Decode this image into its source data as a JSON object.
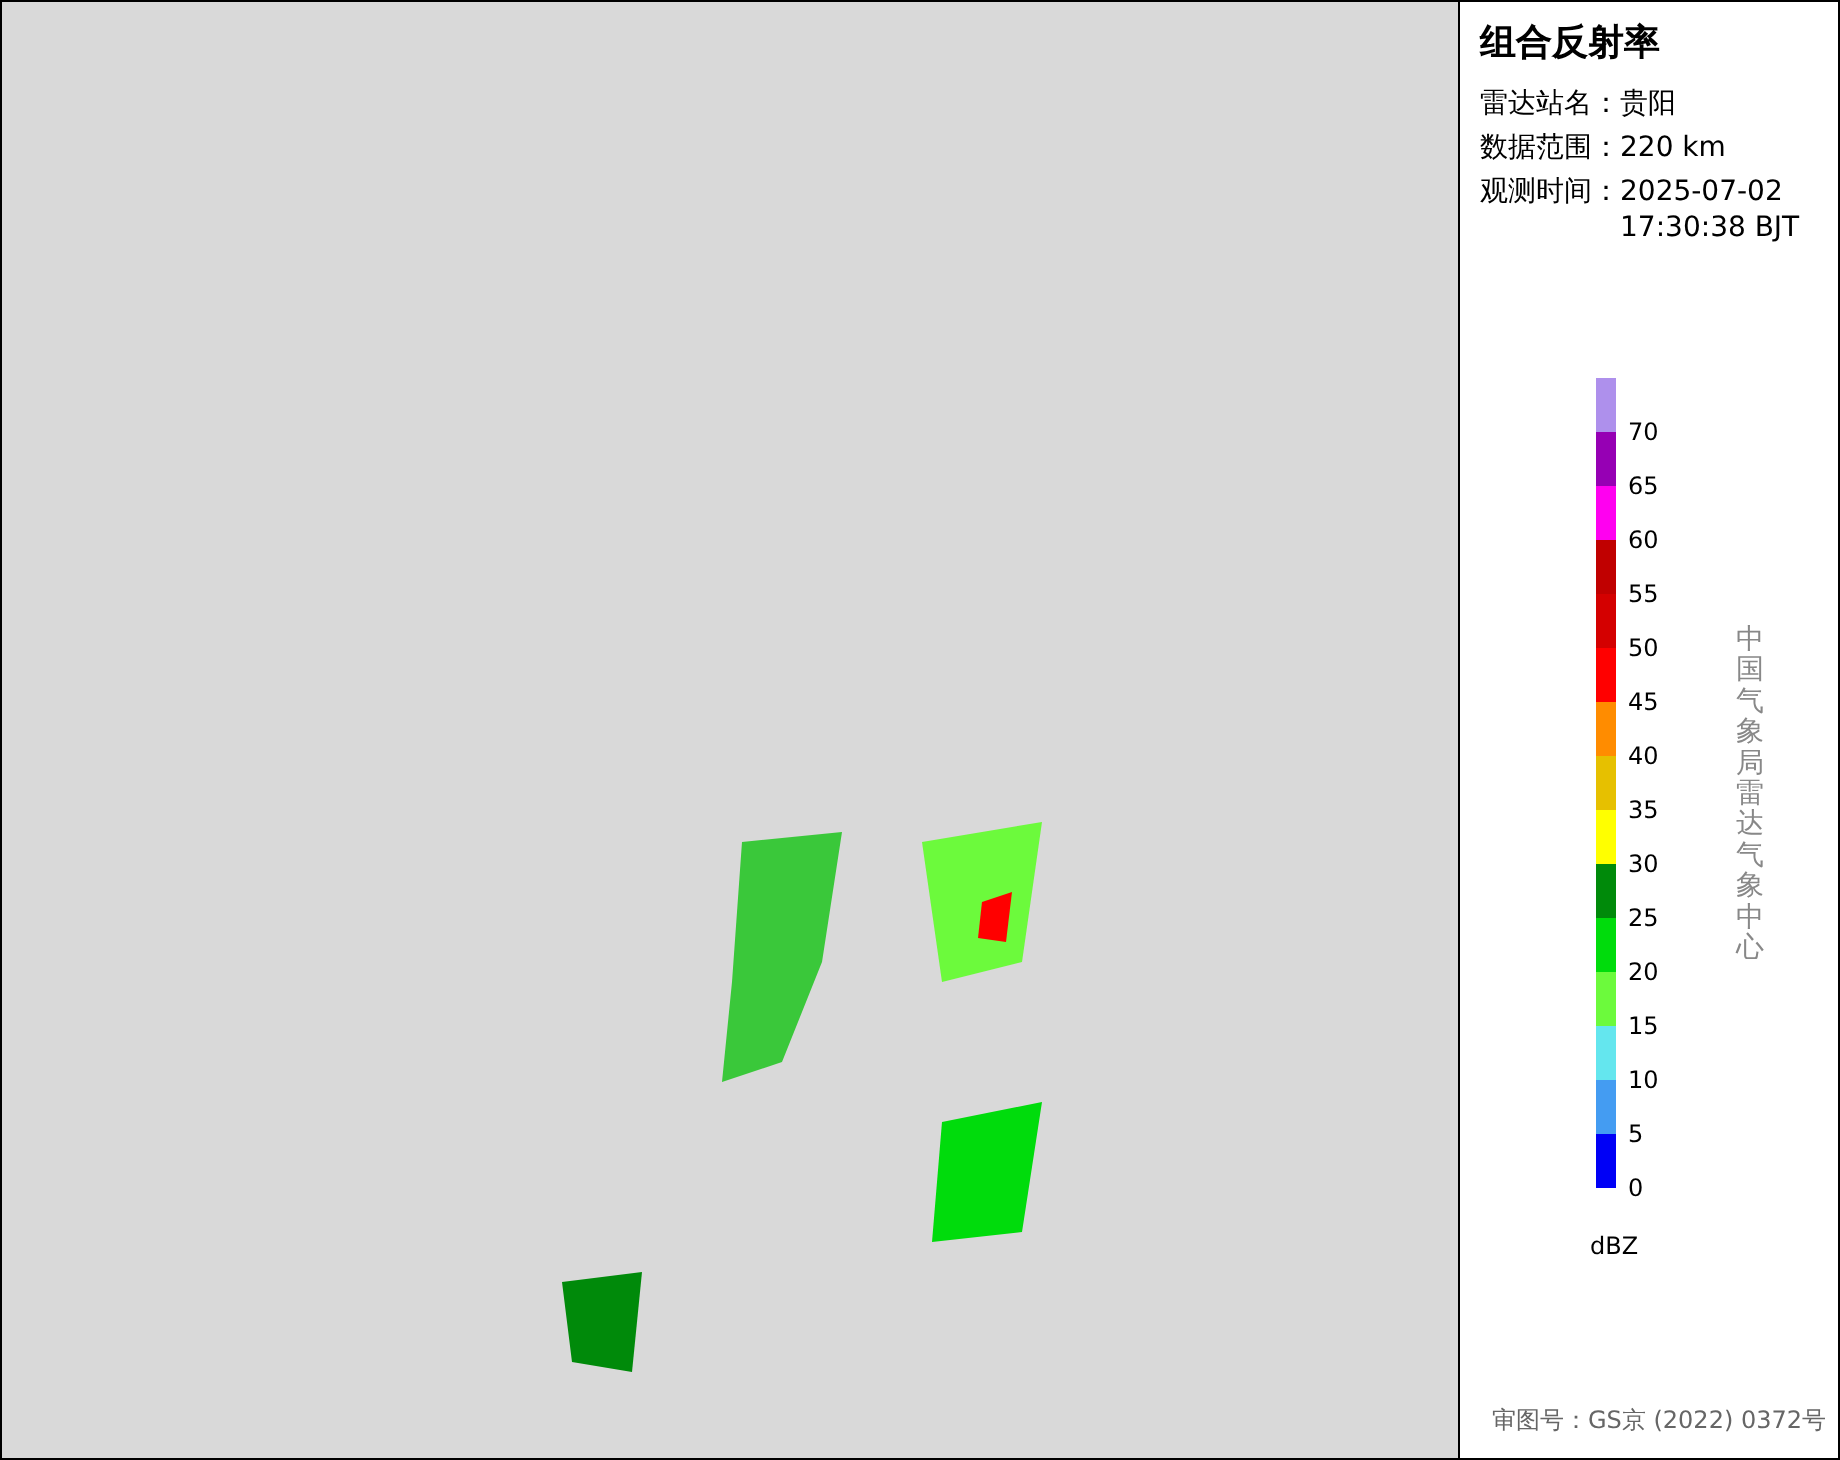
{
  "title": "组合反射率",
  "info": [
    {
      "label": "雷达站名：",
      "value": "贵阳"
    },
    {
      "label": "数据范围：",
      "value": "220 km"
    },
    {
      "label": "观测时间：",
      "value": "2025-07-02\n17:30:38 BJT"
    }
  ],
  "legend": {
    "unit": "dBZ",
    "bins": [
      {
        "label": "70",
        "color": "#ae90ec"
      },
      {
        "label": "65",
        "color": "#9600b4"
      },
      {
        "label": "60",
        "color": "#ff00f0"
      },
      {
        "label": "55",
        "color": "#c00000"
      },
      {
        "label": "50",
        "color": "#d40000"
      },
      {
        "label": "45",
        "color": "#ff0000"
      },
      {
        "label": "40",
        "color": "#ff8c00"
      },
      {
        "label": "35",
        "color": "#e6c000"
      },
      {
        "label": "30",
        "color": "#ffff00"
      },
      {
        "label": "25",
        "color": "#008a0a"
      },
      {
        "label": "20",
        "color": "#00dc0c"
      },
      {
        "label": "15",
        "color": "#6cfa3c"
      },
      {
        "label": "10",
        "color": "#64e6ee"
      },
      {
        "label": "5",
        "color": "#449cf2"
      },
      {
        "label": "0",
        "color": "#0000f6"
      }
    ]
  },
  "credit": "中国气象局雷达气象中心",
  "approval": "审图号：GS京 (2022) 0372号"
}
